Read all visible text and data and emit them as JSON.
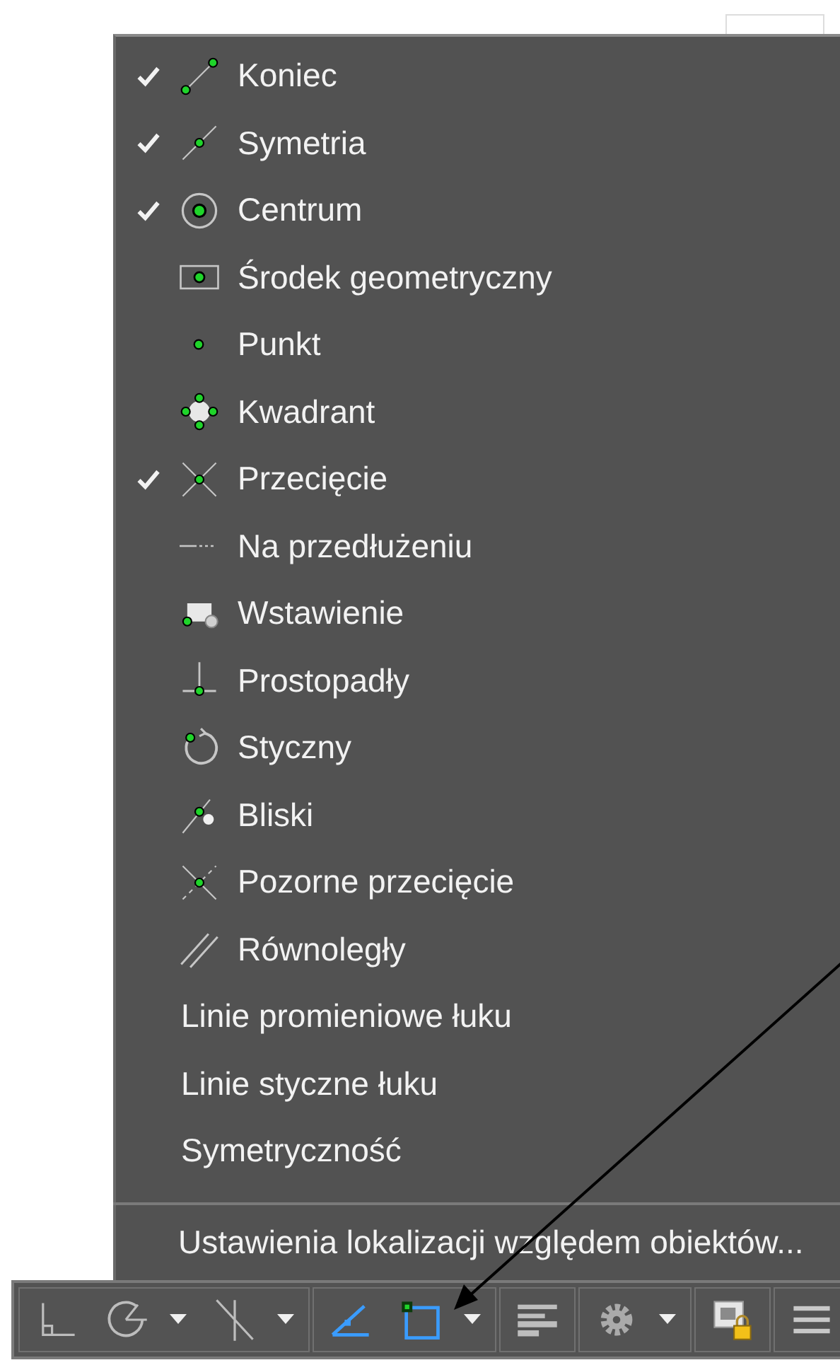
{
  "menu": {
    "items": [
      {
        "kind": "endpoint",
        "label": "Koniec",
        "checked": true
      },
      {
        "kind": "midpoint",
        "label": "Symetria",
        "checked": true
      },
      {
        "kind": "center",
        "label": "Centrum",
        "checked": true
      },
      {
        "kind": "geocenter",
        "label": "Środek geometryczny",
        "checked": false
      },
      {
        "kind": "node",
        "label": "Punkt",
        "checked": false
      },
      {
        "kind": "quadrant",
        "label": "Kwadrant",
        "checked": false
      },
      {
        "kind": "intersection",
        "label": "Przecięcie",
        "checked": true
      },
      {
        "kind": "extension",
        "label": "Na przedłużeniu",
        "checked": false
      },
      {
        "kind": "insertion",
        "label": "Wstawienie",
        "checked": false
      },
      {
        "kind": "perpendicular",
        "label": "Prostopadły",
        "checked": false
      },
      {
        "kind": "tangent",
        "label": "Styczny",
        "checked": false
      },
      {
        "kind": "nearest",
        "label": "Bliski",
        "checked": false
      },
      {
        "kind": "apparent",
        "label": "Pozorne przecięcie",
        "checked": false
      },
      {
        "kind": "parallel",
        "label": "Równoległy",
        "checked": false
      },
      {
        "kind": "plain",
        "label": "Linie promieniowe łuku",
        "checked": false
      },
      {
        "kind": "plain",
        "label": "Linie styczne łuku",
        "checked": false
      },
      {
        "kind": "plain",
        "label": "Symetryczność",
        "checked": false
      }
    ],
    "settings_item": "Ustawienia lokalizacji względem obiektów..."
  },
  "toolbar": {
    "groups": [
      [
        {
          "kind": "ortho",
          "on": false,
          "dropdown": false
        },
        {
          "kind": "polar",
          "on": false,
          "dropdown": true
        },
        {
          "kind": "isometric",
          "on": false,
          "dropdown": true
        }
      ],
      [
        {
          "kind": "tracking",
          "on": true,
          "dropdown": false
        },
        {
          "kind": "osnap",
          "on": true,
          "dropdown": true
        }
      ],
      [
        {
          "kind": "lineweight",
          "on": false,
          "dropdown": false
        }
      ],
      [
        {
          "kind": "gear",
          "dropdown": true
        }
      ],
      [
        {
          "kind": "lock",
          "dropdown": false
        }
      ],
      [
        {
          "kind": "menu",
          "dropdown": false
        }
      ]
    ]
  }
}
